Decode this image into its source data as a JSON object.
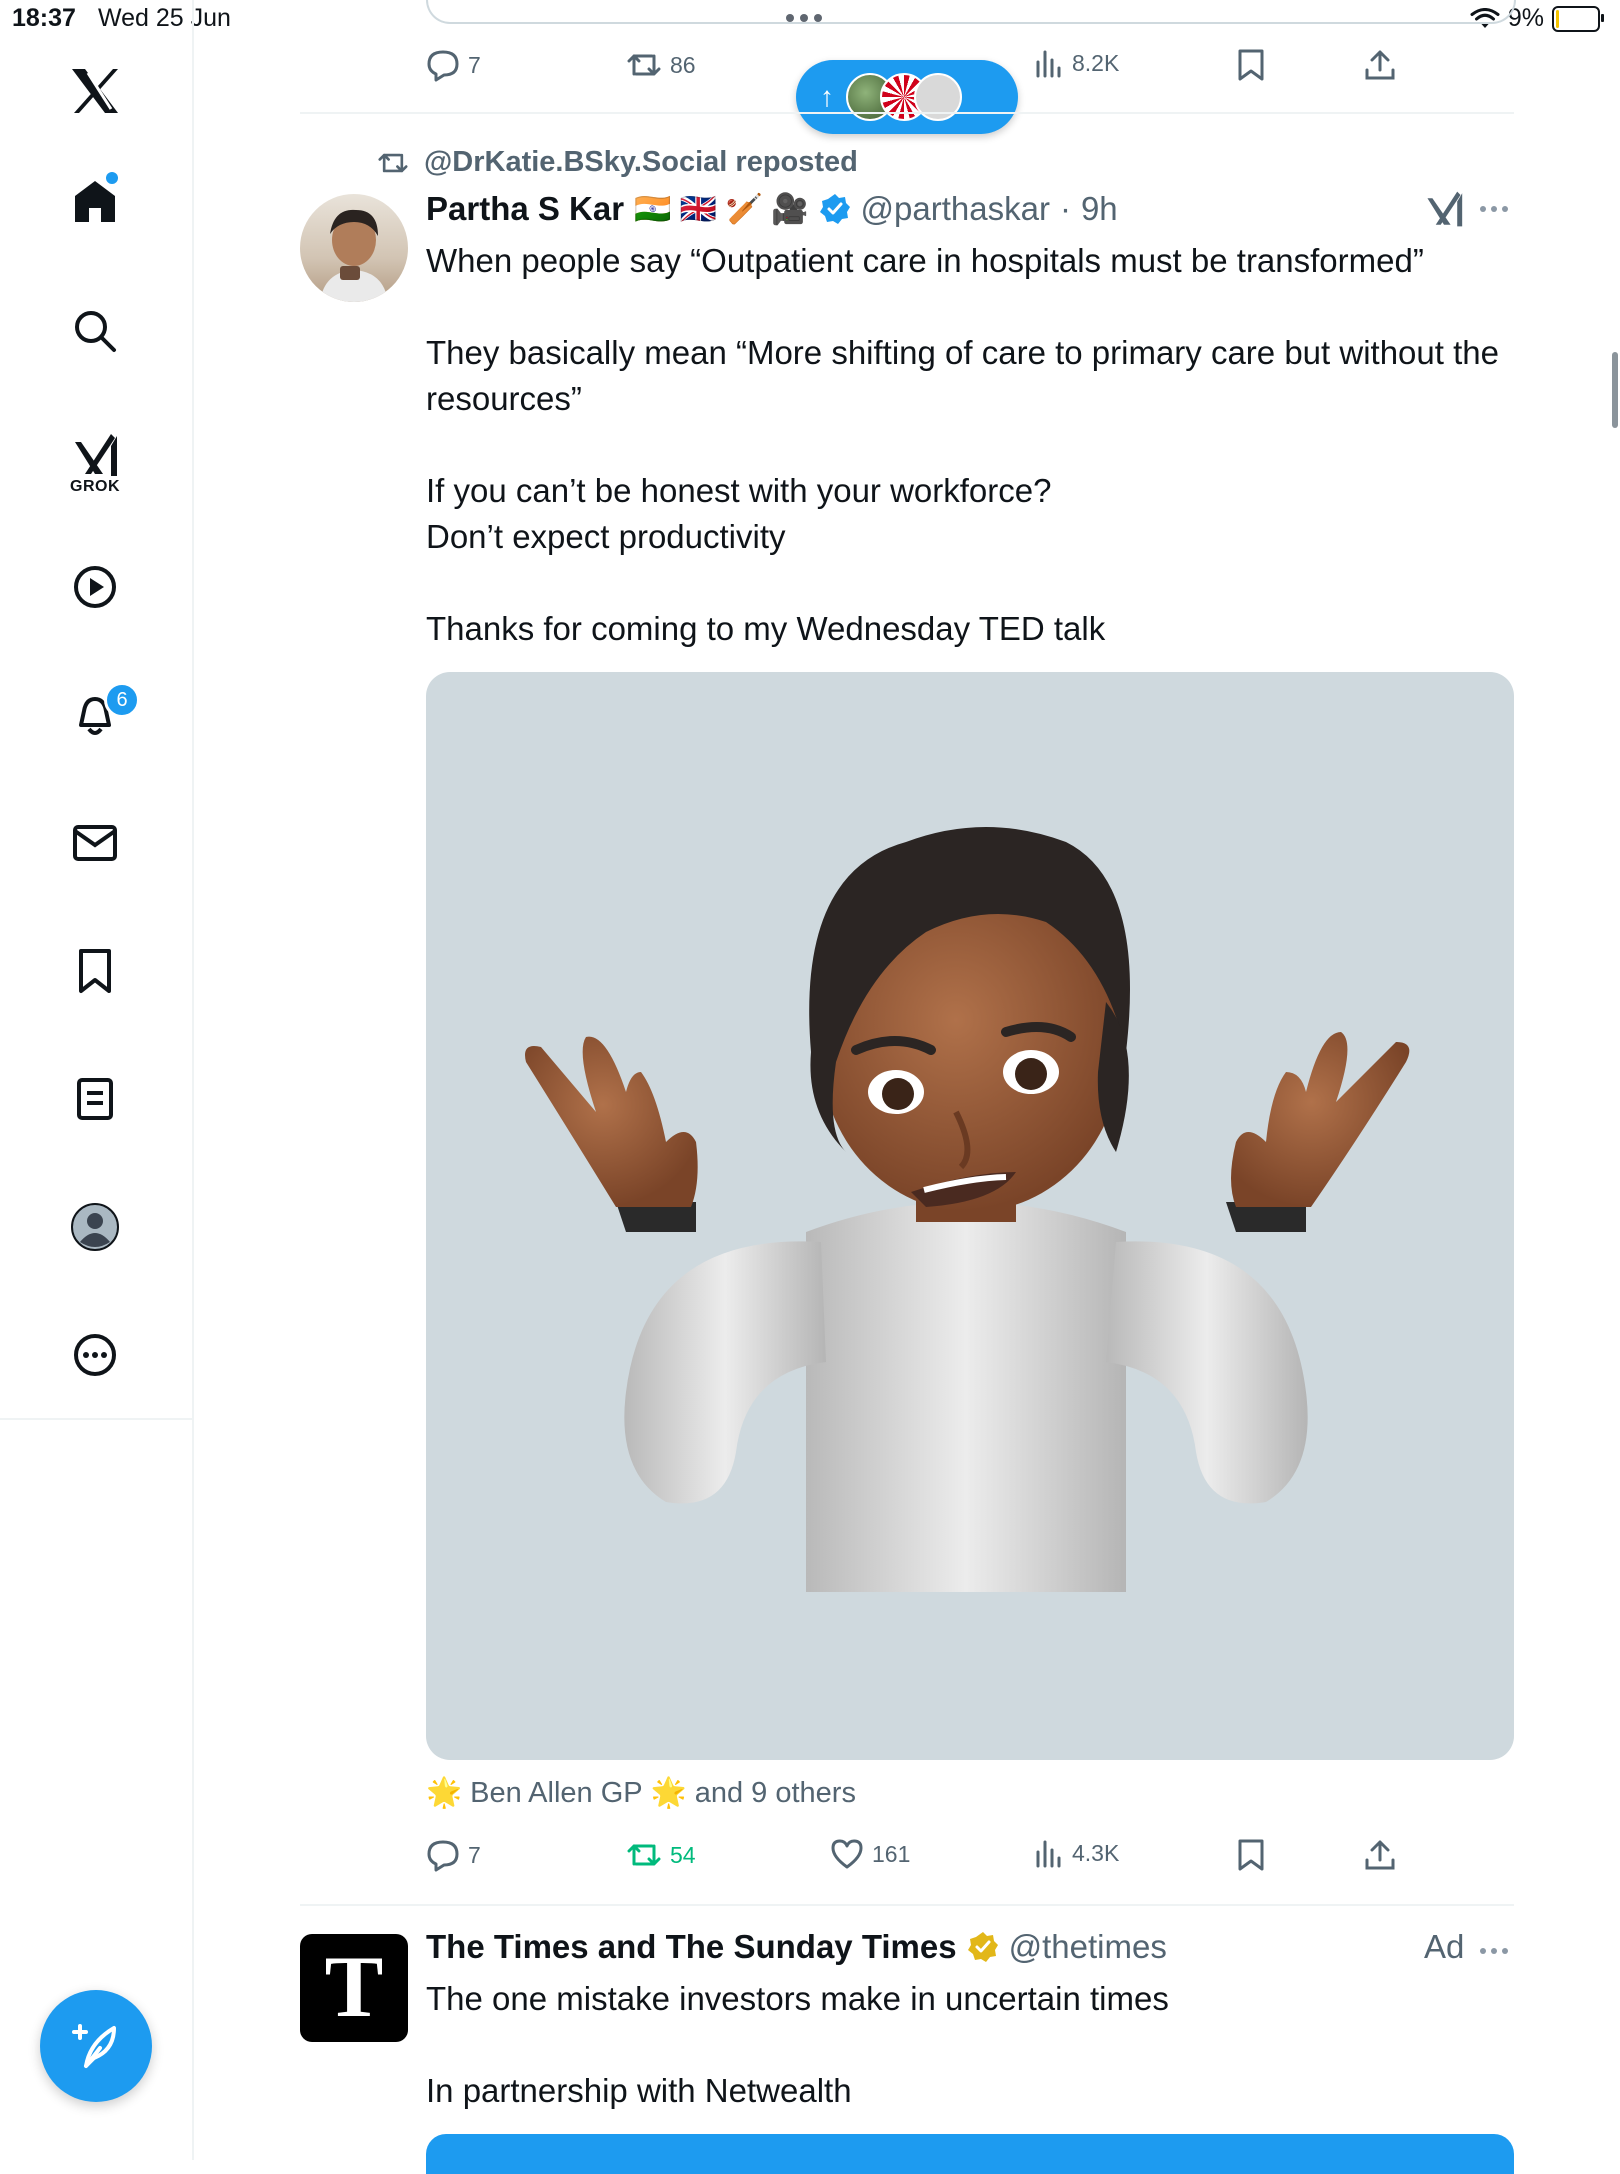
{
  "status_bar": {
    "time": "18:37",
    "date": "Wed 25 Jun",
    "battery": "9%",
    "battery_level": 0.09
  },
  "sidebar": {
    "notifications_badge": "6",
    "grok_label": "GROK",
    "items": [
      "x-logo",
      "home-icon",
      "search-icon",
      "grok-icon",
      "video-icon",
      "notifications-icon",
      "messages-icon",
      "bookmarks-icon",
      "lists-icon",
      "profile-icon",
      "more-icon"
    ]
  },
  "prev_tweet_actions": {
    "replies": "7",
    "reposts": "86",
    "views": "8.2K"
  },
  "new_posts_pill": {
    "arrow": "↑"
  },
  "tweet": {
    "repost_by": "@DrKatie.BSky.Social reposted",
    "name": "Partha S Kar",
    "emojis": "🇮🇳 🇬🇧 🏏 🎥",
    "handle": "@parthaskar",
    "separator": "·",
    "time": "9h",
    "text": "When people say “Outpatient care in hospitals must be transformed”\n\nThey basically mean “More shifting of care to primary care but without the resources”\n\nIf you can’t be honest with your workforce?\nDon’t expect productivity\n\nThanks for coming to my Wednesday TED talk",
    "liked_by_name": "Ben Allen GP",
    "liked_by_star": "🌟",
    "liked_by_rest": "and 9 others",
    "replies": "7",
    "reposts": "54",
    "likes": "161",
    "views": "4.3K"
  },
  "ad": {
    "logo_letter": "T",
    "name": "The Times and The Sunday Times",
    "handle": "@thetimes",
    "ad_label": "Ad",
    "text": "The one mistake investors make in uncertain times\n\nIn partnership with Netwealth"
  },
  "colors": {
    "accent": "#1d9bf0",
    "repost_green": "#00ba7c",
    "muted": "#536471",
    "verified_gold": "#e2b719"
  }
}
